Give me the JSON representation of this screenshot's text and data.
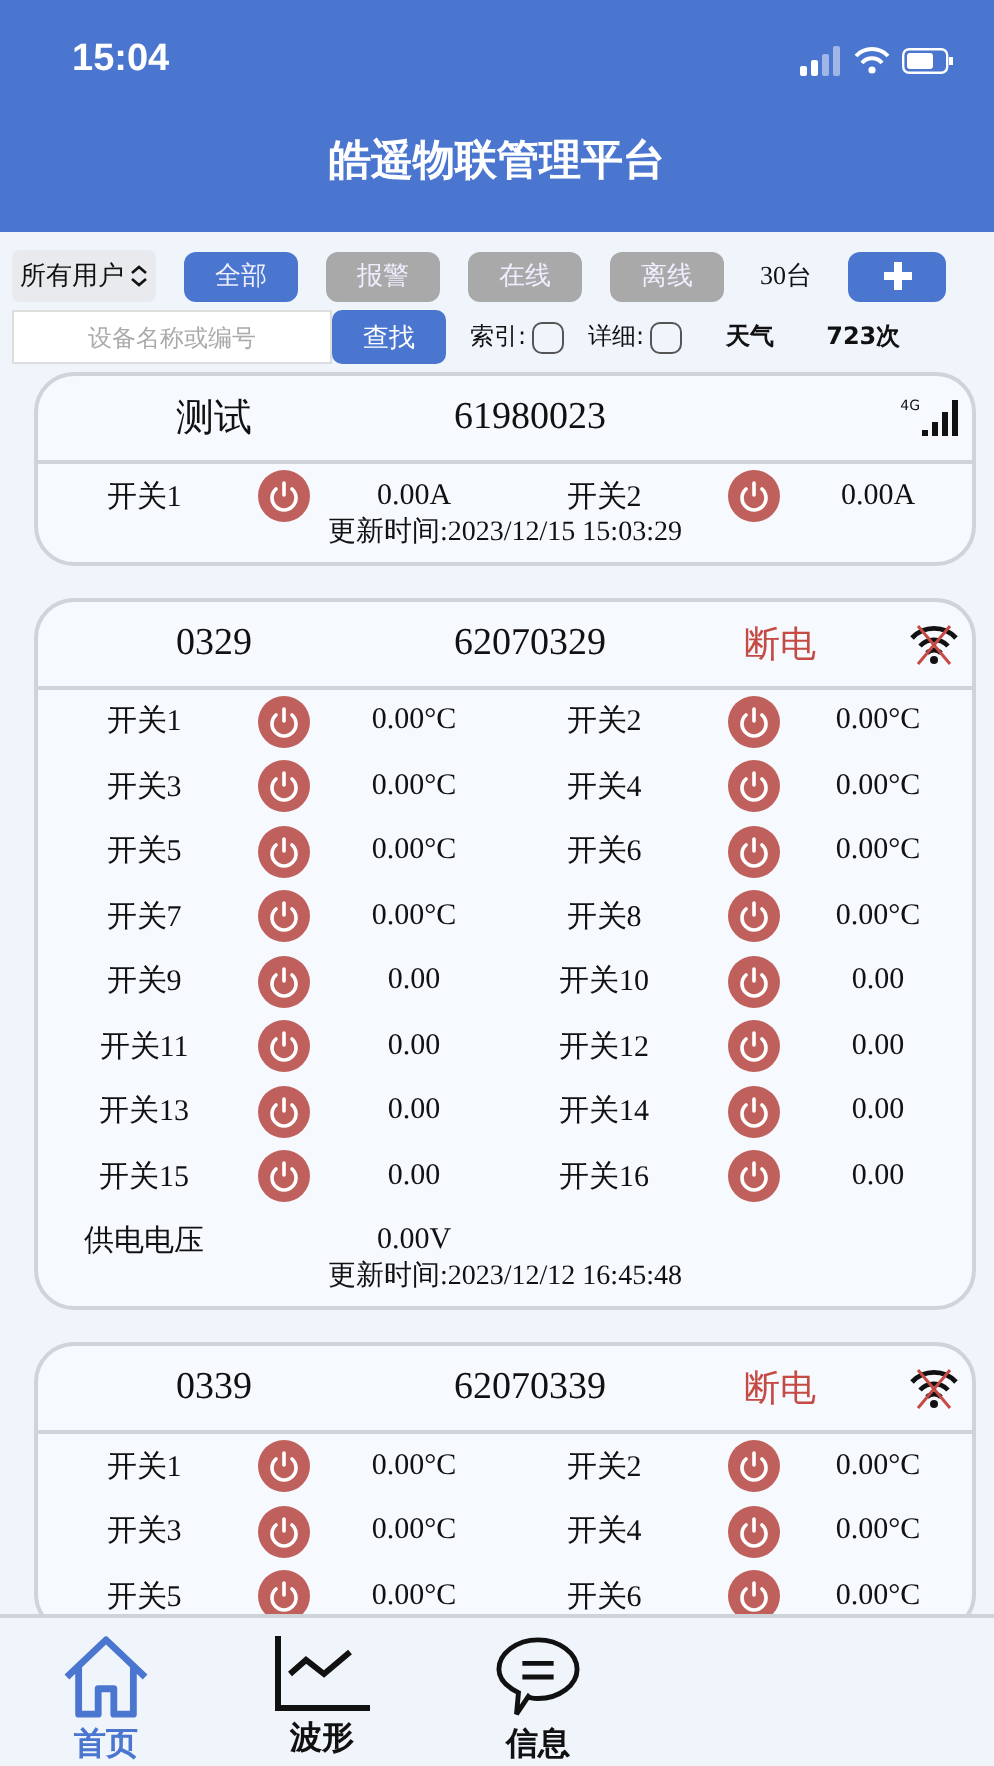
{
  "status_bar": {
    "time": "15:04"
  },
  "title": "皓遥物联管理平台",
  "user_select": {
    "value": "所有用户"
  },
  "filters": [
    {
      "label": "全部",
      "selected": true
    },
    {
      "label": "报警",
      "selected": false
    },
    {
      "label": "在线",
      "selected": false
    },
    {
      "label": "离线",
      "selected": false
    }
  ],
  "device_count": "30台",
  "search": {
    "placeholder": "设备名称或编号",
    "button": "查找"
  },
  "options": [
    {
      "label": "索引:",
      "checked": false
    },
    {
      "label": "详细:",
      "checked": false
    }
  ],
  "weather": "天气",
  "visits": "723次",
  "devices": [
    {
      "name": "测试",
      "code": "61980023",
      "signal": true,
      "network": "4G",
      "switches": [
        {
          "label": "开关1",
          "on": false,
          "reading": "0.00A"
        },
        {
          "label": "开关2",
          "on": false,
          "reading": "0.00A"
        }
      ],
      "updated": "更新时间:2023/12/15 15:03:29"
    },
    {
      "name": "0329",
      "code": "62070329",
      "status": "断电",
      "signal": false,
      "switches": [
        {
          "label": "开关1",
          "on": false,
          "reading": "0.00°C"
        },
        {
          "label": "开关2",
          "on": false,
          "reading": "0.00°C"
        },
        {
          "label": "开关3",
          "on": false,
          "reading": "0.00°C"
        },
        {
          "label": "开关4",
          "on": false,
          "reading": "0.00°C"
        },
        {
          "label": "开关5",
          "on": false,
          "reading": "0.00°C"
        },
        {
          "label": "开关6",
          "on": false,
          "reading": "0.00°C"
        },
        {
          "label": "开关7",
          "on": false,
          "reading": "0.00°C"
        },
        {
          "label": "开关8",
          "on": false,
          "reading": "0.00°C"
        },
        {
          "label": "开关9",
          "on": false,
          "reading": "0.00"
        },
        {
          "label": "开关10",
          "on": false,
          "reading": "0.00"
        },
        {
          "label": "开关11",
          "on": false,
          "reading": "0.00"
        },
        {
          "label": "开关12",
          "on": false,
          "reading": "0.00"
        },
        {
          "label": "开关13",
          "on": false,
          "reading": "0.00"
        },
        {
          "label": "开关14",
          "on": false,
          "reading": "0.00"
        },
        {
          "label": "开关15",
          "on": false,
          "reading": "0.00"
        },
        {
          "label": "开关16",
          "on": false,
          "reading": "0.00"
        }
      ],
      "voltage": {
        "label": "供电电压",
        "value": "0.00V"
      },
      "updated": "更新时间:2023/12/12 16:45:48"
    },
    {
      "name": "0339",
      "code": "62070339",
      "status": "断电",
      "signal": false,
      "switches": [
        {
          "label": "开关1",
          "on": false,
          "reading": "0.00°C"
        },
        {
          "label": "开关2",
          "on": false,
          "reading": "0.00°C"
        },
        {
          "label": "开关3",
          "on": false,
          "reading": "0.00°C"
        },
        {
          "label": "开关4",
          "on": false,
          "reading": "0.00°C"
        },
        {
          "label": "开关5",
          "on": false,
          "reading": "0.00°C"
        },
        {
          "label": "开关6",
          "on": false,
          "reading": "0.00°C"
        }
      ]
    }
  ],
  "tabs": [
    {
      "label": "首页",
      "selected": true
    },
    {
      "label": "波形",
      "selected": false
    },
    {
      "label": "信息",
      "selected": false
    }
  ]
}
